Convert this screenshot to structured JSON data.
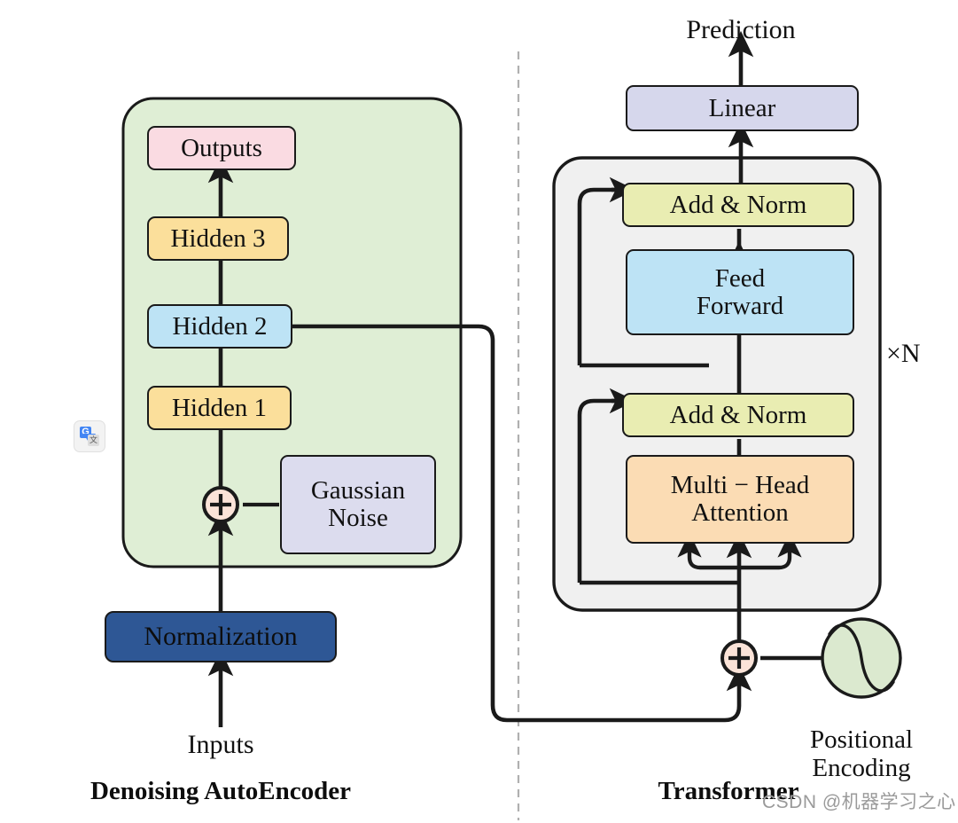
{
  "figure": {
    "left_panel": {
      "title": "Denoising AutoEncoder",
      "input_label": "Inputs",
      "nodes": [
        {
          "id": "outputs",
          "label": "Outputs",
          "color": "#fadbe2"
        },
        {
          "id": "hidden3",
          "label": "Hidden 3",
          "color": "#fbdf9b"
        },
        {
          "id": "hidden2",
          "label": "Hidden 2",
          "color": "#bde3f5"
        },
        {
          "id": "hidden1",
          "label": "Hidden 1",
          "color": "#fbdf9b"
        },
        {
          "id": "gaussian",
          "label": "Gaussian\nNoise",
          "color": "#dcdcee"
        },
        {
          "id": "normalization",
          "label": "Normalization",
          "color": "#2e5795"
        }
      ],
      "container_color": "#dfeed5",
      "adder_symbol": "+"
    },
    "right_panel": {
      "title": "Transformer",
      "output_label": "Prediction",
      "repeat_label": "×N",
      "positional_encoding_label": "Positional\nEncoding",
      "nodes": [
        {
          "id": "linear",
          "label": "Linear",
          "color": "#d6d7ec"
        },
        {
          "id": "addnorm_top",
          "label": "Add & Norm",
          "color": "#e9edb2"
        },
        {
          "id": "feedforward",
          "label": "Feed\nForward",
          "color": "#bde3f5"
        },
        {
          "id": "addnorm_bot",
          "label": "Add & Norm",
          "color": "#e9edb2"
        },
        {
          "id": "attention",
          "label": "Multi − Head\nAttention",
          "color": "#fbdcb4"
        }
      ],
      "block_color": "#f0f0f0",
      "adder_symbol": "+",
      "pe_circle_color": "#dbe9cf"
    },
    "watermark": "CSDN @机器学习之心",
    "translate_icon": {
      "primary_glyph": "G",
      "secondary_glyph": "文"
    },
    "colors": {
      "stroke": "#1a1a1a",
      "divider": "#b0b0b0",
      "adder_fill": "#fbe3d8",
      "normalization_text": "#0d0d0d"
    }
  }
}
